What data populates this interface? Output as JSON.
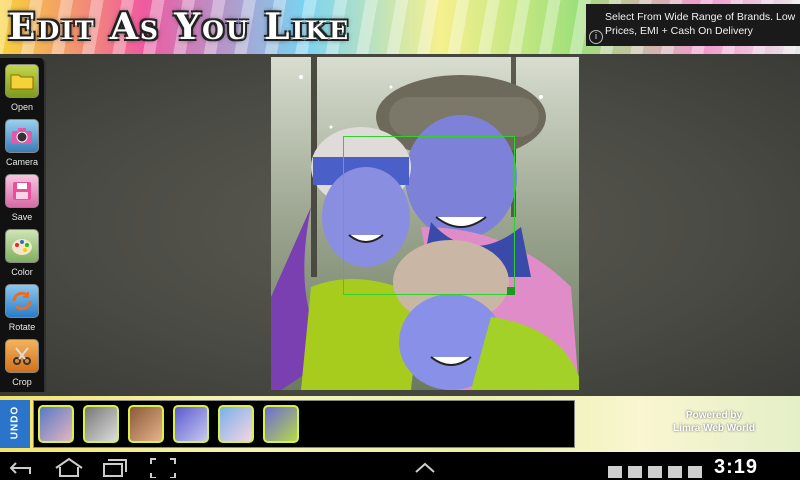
{
  "header": {
    "title": "Edit As You Like"
  },
  "ad": {
    "text": "Select From Wide Range of Brands. Low Prices, EMI + Cash On Delivery",
    "info_label": "i"
  },
  "toolbar": {
    "tools": [
      {
        "label": "Open",
        "icon": "folder-icon"
      },
      {
        "label": "Camera",
        "icon": "camera-icon"
      },
      {
        "label": "Save",
        "icon": "save-icon"
      },
      {
        "label": "Color",
        "icon": "palette-icon"
      },
      {
        "label": "Rotate",
        "icon": "rotate-icon"
      },
      {
        "label": "Crop",
        "icon": "scissors-icon"
      }
    ]
  },
  "history": {
    "undo_label": "UNDO",
    "thumbnails": [
      {
        "icon": "thumbnail-original"
      },
      {
        "icon": "thumbnail-grayscale"
      },
      {
        "icon": "thumbnail-sepia"
      },
      {
        "icon": "thumbnail-purple"
      },
      {
        "icon": "thumbnail-bright"
      },
      {
        "icon": "thumbnail-edited"
      }
    ]
  },
  "footer": {
    "powered_line1": "Powered by",
    "powered_line2": "Limra Web World"
  },
  "status_bar": {
    "time": "3:19"
  },
  "colors": {
    "crop_border": "#2fd12f",
    "thumb_border": "#d7f04a",
    "undo_bg": "#2a74c9"
  }
}
